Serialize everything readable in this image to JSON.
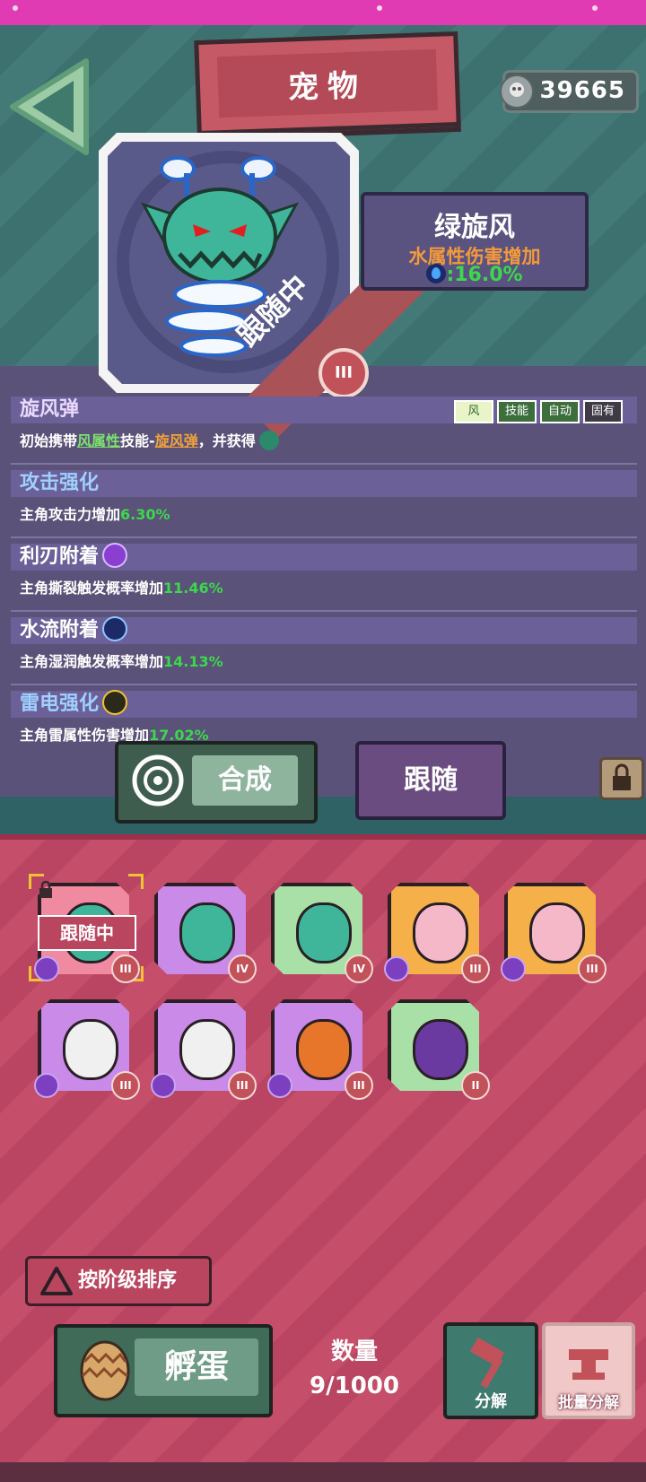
{
  "header": {
    "title": "宠物",
    "currency_value": "39665"
  },
  "pet": {
    "name": "绿旋风",
    "attribute": "水属性伤害增加",
    "attribute_value": ":16.0%",
    "status_ribbon": "跟随中",
    "rank": "III"
  },
  "skills": [
    {
      "title": "旋风弹",
      "desc_prefix": "初始携带",
      "desc_link1": "风属性",
      "desc_mid": "技能-",
      "desc_link2": "旋风弹",
      "desc_suffix": "，并获得",
      "tags": [
        "风",
        "技能",
        "自动",
        "固有"
      ]
    },
    {
      "title": "攻击强化",
      "desc": "主角攻击力增加",
      "value": "6.30%"
    },
    {
      "title": "利刃附着",
      "desc": "主角撕裂触发概率增加",
      "value": "11.46%"
    },
    {
      "title": "水流附着",
      "desc": "主角湿润触发概率增加",
      "value": "14.13%"
    },
    {
      "title": "雷电强化",
      "desc": "主角雷属性伤害增加",
      "value": "17.02%"
    }
  ],
  "actions": {
    "compose_label": "合成",
    "follow_label": "跟随"
  },
  "inventory": {
    "selected_label": "跟随中",
    "cards": [
      {
        "rank": "III",
        "color": "#f08aa0",
        "pet": "#3fb59a",
        "elem": true
      },
      {
        "rank": "IV",
        "color": "#c98ae8",
        "pet": "#3fb59a",
        "elem": false
      },
      {
        "rank": "IV",
        "color": "#a8e0a8",
        "pet": "#3fb59a",
        "elem": false
      },
      {
        "rank": "III",
        "color": "#f5b04a",
        "pet": "#f5b8c8",
        "elem": true
      },
      {
        "rank": "III",
        "color": "#f5b04a",
        "pet": "#f5b8c8",
        "elem": true
      },
      {
        "rank": "III",
        "color": "#c98ae8",
        "pet": "#f0f0f0",
        "elem": true
      },
      {
        "rank": "III",
        "color": "#c98ae8",
        "pet": "#f0f0f0",
        "elem": true
      },
      {
        "rank": "III",
        "color": "#c98ae8",
        "pet": "#e8762a",
        "elem": true
      },
      {
        "rank": "II",
        "color": "#a8e0a8",
        "pet": "#6a3aa0",
        "elem": false
      }
    ]
  },
  "controls": {
    "sort_label": "按阶级排序",
    "hatch_label": "孵蛋",
    "quantity_label": "数量",
    "quantity_value": "9/1000",
    "decompose_label": "分解",
    "batch_decompose_label": "批量分解"
  }
}
